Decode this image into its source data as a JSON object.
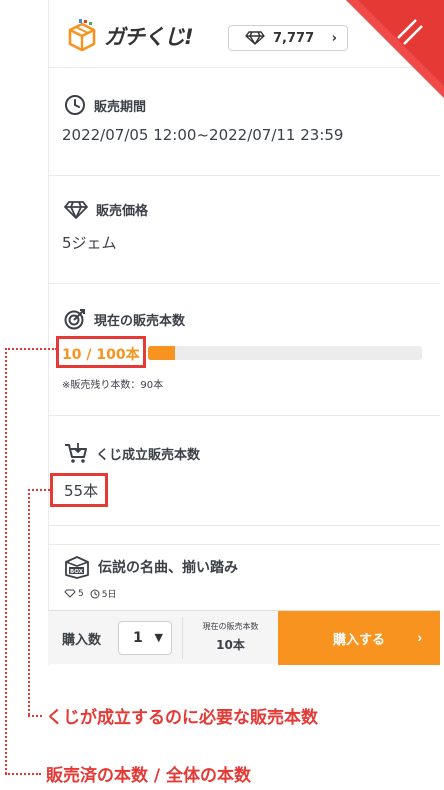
{
  "header": {
    "logo_text": "ガチくじ!",
    "gem_count": "7,777",
    "gem_icon": "diamond-icon",
    "menu_icon": "hamburger-icon"
  },
  "sections": {
    "period": {
      "title": "販売期間",
      "value": "2022/07/05 12:00~2022/07/11 23:59",
      "icon": "clock-icon"
    },
    "price": {
      "title": "販売価格",
      "value": "5ジェム",
      "icon": "diamond-icon"
    },
    "current_sales": {
      "title": "現在の販売本数",
      "value": "10 / 100本",
      "progress_percent": 10,
      "remaining": "※販売残り本数：90本",
      "icon": "target-icon"
    },
    "threshold": {
      "title": "くじ成立販売本数",
      "value": "55本",
      "icon": "cart-icon"
    }
  },
  "card": {
    "title": "伝説の名曲、揃い踏み",
    "box_icon_label": "BOX",
    "price_meta": "5",
    "days_meta": "5日"
  },
  "purchase": {
    "qty_label": "購入数",
    "qty_value": "1",
    "sold_caption": "現在の販売本数",
    "sold_value": "10本",
    "buy_label": "購入する"
  },
  "annotations": {
    "threshold_note": "くじが成立するのに必要な販売本数",
    "progress_note": "販売済の本数 / 全体の本数"
  },
  "colors": {
    "accent": "#f7931e",
    "annotation": "#e53935"
  }
}
